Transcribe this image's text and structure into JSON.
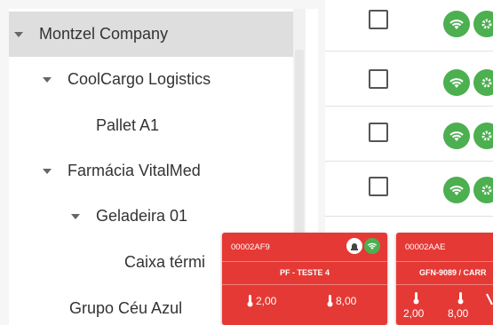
{
  "tree": {
    "items": [
      {
        "label": "Montzel Company",
        "level": 0,
        "expanded": true,
        "selected": true
      },
      {
        "label": "CoolCargo Logistics",
        "level": 1,
        "expanded": true,
        "selected": false
      },
      {
        "label": "Pallet A1",
        "level": 2,
        "expanded": false,
        "selected": false
      },
      {
        "label": "Farmácia VitalMed",
        "level": 1,
        "expanded": true,
        "selected": false
      },
      {
        "label": "Geladeira 01",
        "level": 2,
        "expanded": true,
        "selected": false
      },
      {
        "label": "Caixa térmi",
        "level": 3,
        "expanded": false,
        "selected": false
      },
      {
        "label": "Grupo Céu Azul",
        "level": 1,
        "expanded": false,
        "selected": false
      }
    ]
  },
  "cards": [
    {
      "id": "00002AF9",
      "name": "PF - TESTE 4",
      "temp_min": "2,00",
      "temp_max": "8,00",
      "color": "#e53935"
    },
    {
      "id": "00002AAE",
      "name": "GFN-9089 / CARR",
      "temp_min": "2,00",
      "temp_max": "8,00",
      "color": "#e53935"
    }
  ],
  "colors": {
    "status_online": "#4caf50",
    "alarm_red": "#e53935",
    "selected_row": "#dedede"
  }
}
